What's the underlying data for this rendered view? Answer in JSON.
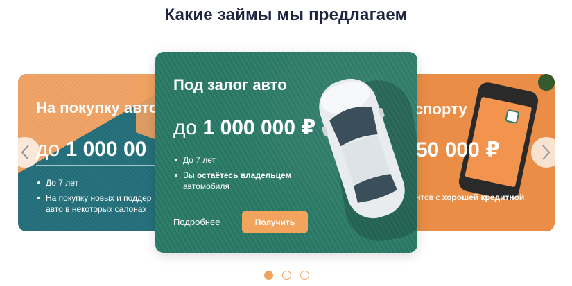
{
  "heading": "Какие займы мы предлагаем",
  "cards": {
    "left": {
      "title": "На покупку авто",
      "amount_prefix": "до",
      "amount_value": "1 000 00",
      "bullets": [
        {
          "text": "До 7 лет"
        },
        {
          "text_line1": "На покупку новых и поддер",
          "text_line2_start": "авто в ",
          "link": "некоторых салонах"
        }
      ]
    },
    "center": {
      "title": "Под залог авто",
      "amount_prefix": "до",
      "amount_value": "1 000 000 ₽",
      "bullets": [
        {
          "text": "До 7 лет"
        },
        {
          "start": "Вы ",
          "bold": "остаётесь владельцем",
          "end": "автомобиля"
        }
      ],
      "more_link": "Подробнее",
      "get_button": "Получить"
    },
    "right": {
      "title": "спорту",
      "amount_value": "50 000 ₽",
      "text_start": "нтов с ",
      "text_bold": "хорошей кредитной"
    }
  },
  "pagination": {
    "count": 3,
    "active_index": 0
  },
  "colors": {
    "orange_accent": "#f2a35e",
    "green_card": "#2a7a67",
    "teal_card": "#226f7a",
    "heading_text": "#1f2540"
  }
}
